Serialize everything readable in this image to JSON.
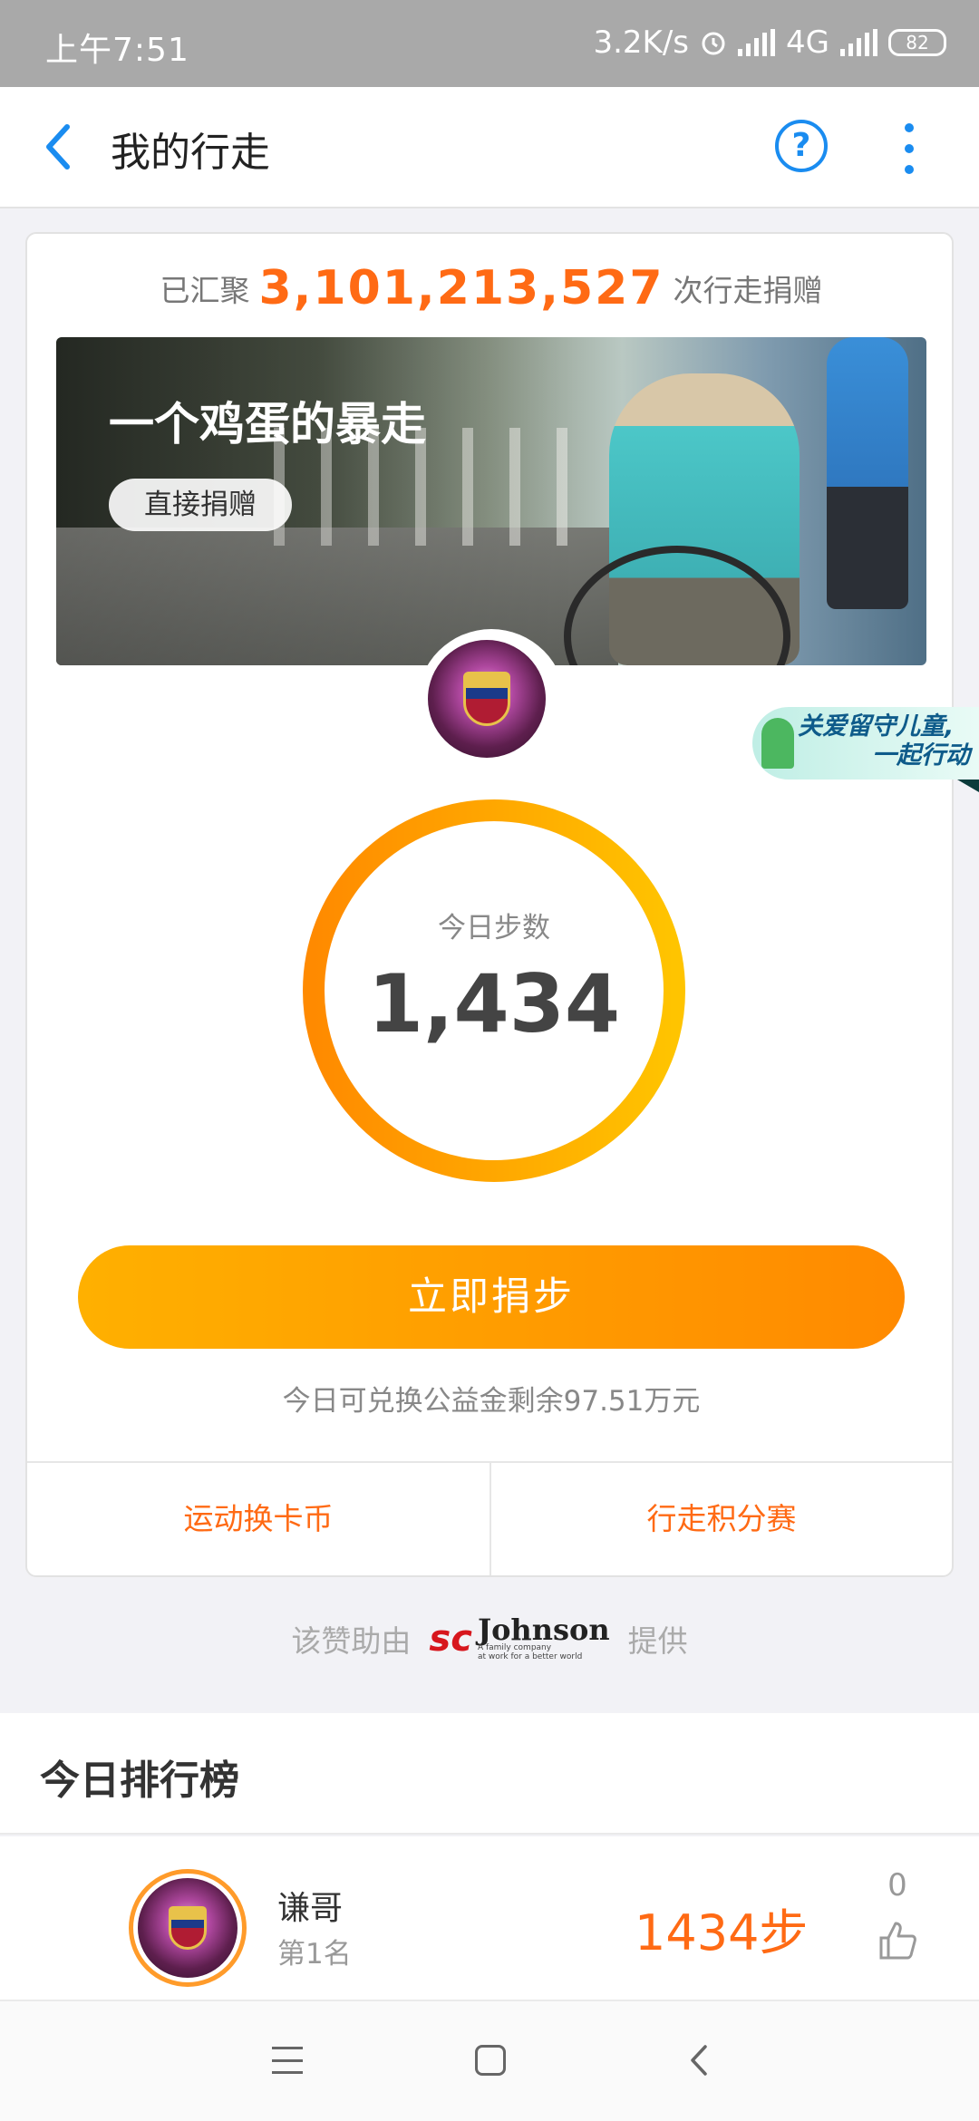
{
  "status_bar": {
    "time": "上午7:51",
    "network_speed": "3.2K/s",
    "network_type": "4G",
    "battery": "82"
  },
  "header": {
    "title": "我的行走"
  },
  "summary": {
    "prefix": "已汇聚",
    "count": "3,101,213,527",
    "suffix": "次行走捐赠"
  },
  "banner": {
    "title": "一个鸡蛋的暴走",
    "button_label": "直接捐赠"
  },
  "side_badge": {
    "line1": "关爱留守儿童,",
    "line2": "一起行动"
  },
  "steps": {
    "label": "今日步数",
    "value": "1,434"
  },
  "donate_button": "立即捐步",
  "remaining_text": "今日可兑换公益金剩余97.51万元",
  "card_links": [
    "运动换卡币",
    "行走积分赛"
  ],
  "sponsor": {
    "prefix": "该赞助由",
    "brand_sc": "sc",
    "brand_name": "Johnson",
    "brand_tagline_1": "A family company",
    "brand_tagline_2": "at work for a better world",
    "suffix": "提供"
  },
  "leaderboard": {
    "title": "今日排行榜",
    "rows": [
      {
        "name": "谦哥",
        "rank": "第1名",
        "steps": "1434步",
        "likes": "0"
      }
    ]
  },
  "colors": {
    "accent_orange": "#ff6a14",
    "button_gradient_start": "#ffb000",
    "button_gradient_end": "#ff8a00",
    "nav_blue": "#1a8cf0"
  },
  "icons": [
    "back-arrow-icon",
    "help-icon",
    "more-vertical-icon",
    "alarm-icon",
    "signal-icon",
    "battery-icon",
    "thumbs-up-icon",
    "menu-icon",
    "home-icon",
    "back-icon"
  ]
}
